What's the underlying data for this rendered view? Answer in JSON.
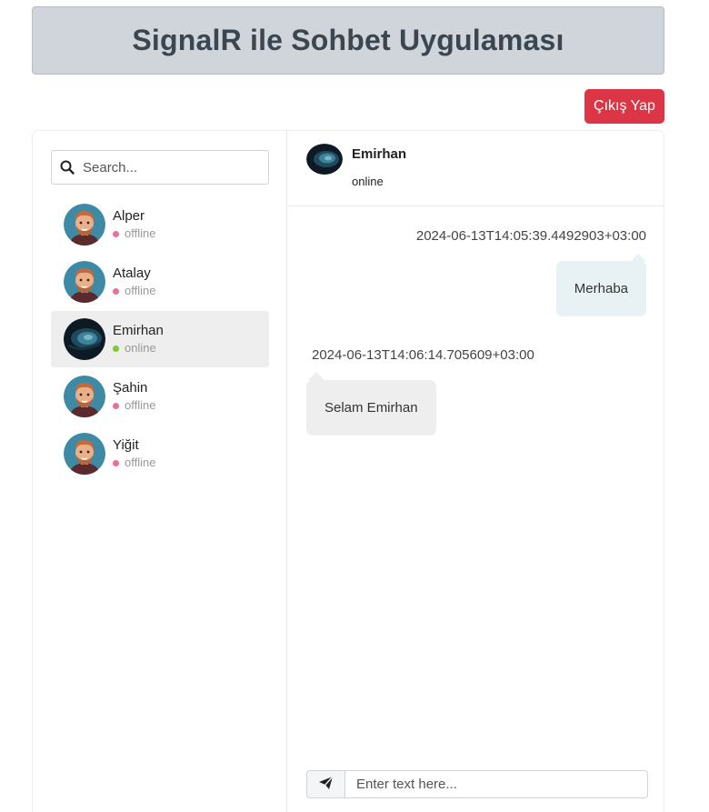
{
  "header": {
    "title": "SignalR ile Sohbet Uygulaması"
  },
  "logout": {
    "label": "Çıkış Yap"
  },
  "search": {
    "placeholder": "Search..."
  },
  "people": [
    {
      "name": "Alper",
      "status": "offline",
      "avatar": "cartoon-man-avatar"
    },
    {
      "name": "Atalay",
      "status": "offline",
      "avatar": "cartoon-man-avatar"
    },
    {
      "name": "Emirhan",
      "status": "online",
      "avatar": "dark-blue-photo-avatar",
      "active": true
    },
    {
      "name": "Şahin",
      "status": "offline",
      "avatar": "cartoon-man-avatar"
    },
    {
      "name": "Yiğit",
      "status": "offline",
      "avatar": "cartoon-man-avatar"
    }
  ],
  "chat": {
    "name": "Emirhan",
    "status": "online",
    "messages": [
      {
        "direction": "out",
        "time": "2024-06-13T14:05:39.4492903+03:00",
        "text": "Merhaba"
      },
      {
        "direction": "in",
        "time": "2024-06-13T14:06:14.705609+03:00",
        "text": "Selam Emirhan"
      }
    ]
  },
  "composer": {
    "placeholder": "Enter text here...",
    "send_icon": "paper-plane-icon"
  },
  "colors": {
    "danger": "#dc3545",
    "online": "#86c541",
    "offline": "#e8709a",
    "header_bg": "#d0d4db"
  }
}
